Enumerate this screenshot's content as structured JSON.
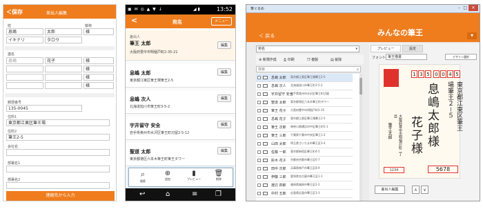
{
  "p1": {
    "back_label": "＜保存",
    "title": "差出人編集",
    "labels": {
      "name_last": "姓",
      "name_first": "名",
      "honorific": "敬称",
      "name_last_alt": "連名",
      "zip": "郵便番号",
      "addr1": "住所1",
      "addr2": "住所2",
      "company": "会社名",
      "dept1": "部署名1",
      "dept2": "部署名2"
    },
    "last_name": "息嶋",
    "first_name": "太郎",
    "honorific": "様",
    "last_kana": "イキナリ",
    "first_kana": "タロウ",
    "joint_rows": [
      {
        "last": "息嶋",
        "first": "花子",
        "honor": "様"
      },
      {
        "last": "",
        "first": "",
        "honor": "様"
      },
      {
        "last": "",
        "first": "",
        "honor": "様"
      },
      {
        "last": "",
        "first": "",
        "honor": "様"
      }
    ],
    "zip": "135-0045",
    "addr1": "東京都江東区筆王場",
    "addr2": "筆王2-5",
    "submit_label": "連絡先から入力"
  },
  "p2": {
    "status_time": "13:52",
    "title": "宛名",
    "menu_label": "メニュー",
    "cards": [
      {
        "tag": "差出人",
        "name": "筆王 太郎",
        "addr": "大阪府豊中市明稲戸町2-35-21",
        "edit": ""
      },
      {
        "name": "息嶋 太郎",
        "addr": "東京都江東区筆王場筆王2-5",
        "edit": "編集"
      },
      {
        "name": "息嶋 次人",
        "addr": "北海道旭川市筆王町3-5-2",
        "edit": "編集"
      },
      {
        "name": "宇井留守 安全",
        "addr": "岩手県奥州市水沢区筆王町辺屋2-5-12",
        "edit": "編集"
      },
      {
        "name": "聖道 太郎",
        "addr": "東京都港区六本木筆王町筆王タワー",
        "edit": "編集"
      }
    ],
    "tool_labels": [
      "検索",
      "追加",
      "プレビュー",
      "削除"
    ],
    "edit_label": "編集"
  },
  "p3": {
    "window_title": "筆ぐるめ",
    "back_label": "＜ 戻る",
    "brand": "みんなの筆王",
    "toolbar": [
      "新規作成",
      "印刷",
      "複製",
      "削除"
    ],
    "search_placeholder": "検索",
    "dropdown_value": "宛名",
    "tabs": [
      "プレビュー",
      "設定"
    ],
    "font_label": "フォント",
    "font_value": "筆王楷書",
    "design_button": "デザイン選択",
    "rows": [
      {
        "n": "息嶋 太郎",
        "a": "東京都江東区筆王場筆王2-5"
      },
      {
        "n": "息嶋 次人",
        "a": "北海道旭川市筆王町3-5-2"
      },
      {
        "n": "宇井留守 安全",
        "a": "岩手県奥州市水沢区筆王町辺屋"
      },
      {
        "n": "聖道 太郎",
        "a": "東京都港区六本木筆王町タワー"
      },
      {
        "n": "筆王 花子",
        "a": "大阪府豊中市明稲戸町2-35"
      },
      {
        "n": "息嶋 花子",
        "a": "東京都江東区筆王場筆王2-5"
      },
      {
        "n": "筆王 次郎",
        "a": "神奈川県横浜市中区筆王町5-1"
      },
      {
        "n": "筆王 三郎",
        "a": "千葉県千葉市中央区筆王1-2"
      },
      {
        "n": "山田 太郎",
        "a": "埼玉県さいたま市筆王区3-4"
      },
      {
        "n": "佐藤 一郎",
        "a": "東京都新宿区筆王町4-5"
      },
      {
        "n": "鈴木 花子",
        "a": "京都府京都市筆王区6-7"
      },
      {
        "n": "田中 次郎",
        "a": "兵庫県神戸市筆王区8-9"
      },
      {
        "n": "伊藤 三郎",
        "a": "愛知県名古屋市筆王区1-1"
      },
      {
        "n": "渡辺 四郎",
        "a": "福岡県福岡市筆王区2-2"
      },
      {
        "n": "中村 五郎",
        "a": "広島県広島市筆王区3-3"
      },
      {
        "n": "小林 六郎",
        "a": "宮城県仙台市筆王区4-4"
      },
      {
        "n": "加藤 七郎",
        "a": "北海道札幌市筆王区5-5"
      }
    ],
    "postcard": {
      "zip_digits": [
        "1",
        "3",
        "5",
        "0",
        "0",
        "4",
        "5"
      ],
      "address": "東京都江東区筆王場筆王２－５",
      "name": "息嶋太郎様",
      "joint": "花子様",
      "sender_zip": "5678",
      "sender_addr": "大阪府豊中市明稲戸町二丁目",
      "sender_name": "筆王太郎"
    },
    "bottom_button": "差出人編集"
  },
  "colors": {
    "accent": "#ef7d1e"
  }
}
